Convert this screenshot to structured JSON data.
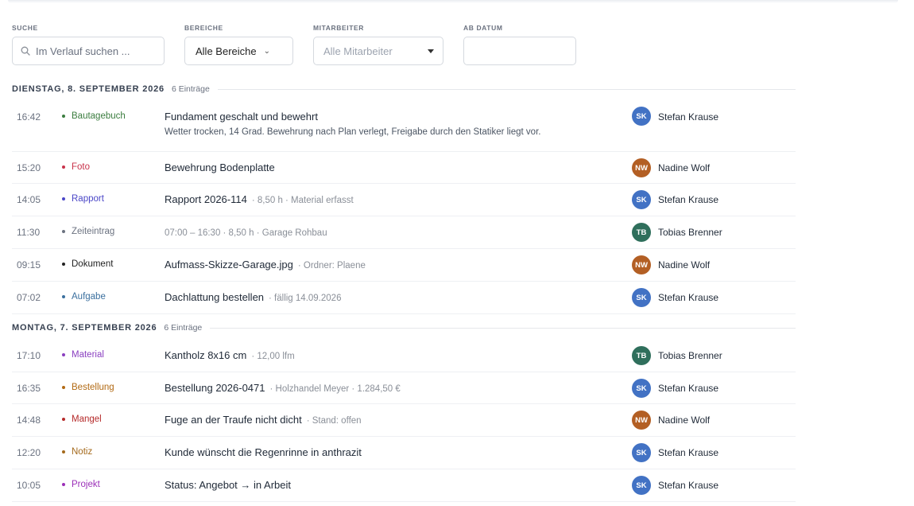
{
  "filters": {
    "search": {
      "label": "SUCHE",
      "placeholder": "Im Verlauf suchen ..."
    },
    "areas": {
      "label": "BEREICHE",
      "value": "Alle Bereiche"
    },
    "staff": {
      "label": "MITARBEITER",
      "value": "Alle Mitarbeiter"
    },
    "date": {
      "label": "AB DATUM",
      "value": ""
    }
  },
  "groups": [
    {
      "title": "DIENSTAG, 8. SEPTEMBER 2026",
      "count": "6 Einträge",
      "entries": [
        {
          "time": "16:42",
          "category": "Bautagebuch",
          "color": "#3b7d3f",
          "title": "Fundament geschalt und bewehrt",
          "meta": "",
          "desc": "Wetter trocken, 14 Grad. Bewehrung nach Plan verlegt, Freigabe durch den Statiker liegt vor.",
          "initials": "SK",
          "avatar_color": "#4272c4",
          "user": "Stefan Krause"
        },
        {
          "time": "15:20",
          "category": "Foto",
          "color": "#c8324a",
          "title": "Bewehrung Bodenplatte",
          "meta": "",
          "desc": "",
          "initials": "NW",
          "avatar_color": "#b35f24",
          "user": "Nadine Wolf"
        },
        {
          "time": "14:05",
          "category": "Rapport",
          "color": "#4a46c7",
          "title": "Rapport 2026-114",
          "meta": "· 8,50 h · Material erfasst",
          "desc": "",
          "initials": "SK",
          "avatar_color": "#4272c4",
          "user": "Stefan Krause"
        },
        {
          "time": "11:30",
          "category": "Zeiteintrag",
          "color": "#6b7280",
          "title": "",
          "meta": "07:00 – 16:30 · 8,50 h · Garage Rohbau",
          "desc": "",
          "initials": "TB",
          "avatar_color": "#2f6f5c",
          "user": "Tobias Brenner"
        },
        {
          "time": "09:15",
          "category": "Dokument",
          "color": "#222222",
          "title": "Aufmass-Skizze-Garage.jpg",
          "meta": "· Ordner: Plaene",
          "desc": "",
          "initials": "NW",
          "avatar_color": "#b35f24",
          "user": "Nadine Wolf"
        },
        {
          "time": "07:02",
          "category": "Aufgabe",
          "color": "#3a6f9e",
          "title": "Dachlattung bestellen",
          "meta": "· fällig 14.09.2026",
          "desc": "",
          "initials": "SK",
          "avatar_color": "#4272c4",
          "user": "Stefan Krause"
        }
      ]
    },
    {
      "title": "MONTAG, 7. SEPTEMBER 2026",
      "count": "6 Einträge",
      "entries": [
        {
          "time": "17:10",
          "category": "Material",
          "color": "#8a3fc0",
          "title": "Kantholz 8x16 cm",
          "meta": "· 12,00 lfm",
          "desc": "",
          "initials": "TB",
          "avatar_color": "#2f6f5c",
          "user": "Tobias Brenner"
        },
        {
          "time": "16:35",
          "category": "Bestellung",
          "color": "#b26a14",
          "title": "Bestellung 2026-0471",
          "meta": "· Holzhandel Meyer · 1.284,50 €",
          "desc": "",
          "initials": "SK",
          "avatar_color": "#4272c4",
          "user": "Stefan Krause"
        },
        {
          "time": "14:48",
          "category": "Mangel",
          "color": "#b52a2a",
          "title": "Fuge an der Traufe nicht dicht",
          "meta": "· Stand: offen",
          "desc": "",
          "initials": "NW",
          "avatar_color": "#b35f24",
          "user": "Nadine Wolf"
        },
        {
          "time": "12:20",
          "category": "Notiz",
          "color": "#a46a1c",
          "title": "Kunde wünscht die Regenrinne in anthrazit",
          "meta": "",
          "desc": "",
          "initials": "SK",
          "avatar_color": "#4272c4",
          "user": "Stefan Krause"
        },
        {
          "time": "10:05",
          "category": "Projekt",
          "color": "#9b2fb8",
          "title": "Status: Angebot → in Arbeit",
          "meta": "",
          "desc": "",
          "initials": "SK",
          "avatar_color": "#4272c4",
          "user": "Stefan Krause"
        }
      ]
    }
  ]
}
